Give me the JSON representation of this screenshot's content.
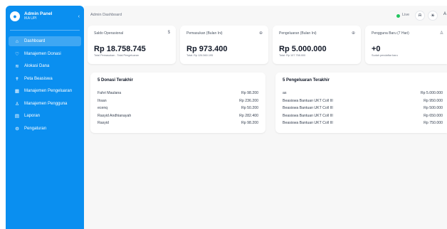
{
  "sidebar": {
    "brand_title": "Admin Panel",
    "brand_subtitle": "IKA UPI",
    "items": [
      {
        "label": "Dashboard",
        "icon": "home-icon",
        "glyph": "⌂"
      },
      {
        "label": "Manajemen Donasi",
        "icon": "donation-icon",
        "glyph": "♡"
      },
      {
        "label": "Alokasi Dana",
        "icon": "allocation-icon",
        "glyph": "≋"
      },
      {
        "label": "Peta Beasiswa",
        "icon": "map-pin-icon",
        "glyph": "✝"
      },
      {
        "label": "Manajemen Pengeluaran",
        "icon": "expense-icon",
        "glyph": "▦"
      },
      {
        "label": "Manajemen Pengguna",
        "icon": "users-icon",
        "glyph": "♙"
      },
      {
        "label": "Laporan",
        "icon": "report-icon",
        "glyph": "▤"
      },
      {
        "label": "Pengaturan",
        "icon": "settings-icon",
        "glyph": "⚙"
      }
    ]
  },
  "topbar": {
    "breadcrumb": "Admin Dashboard",
    "live_label": "Live",
    "user_initial": "A"
  },
  "stats": [
    {
      "label": "Saldo Operasional",
      "icon": "$",
      "value": "Rp 18.758.745",
      "note": "Total Pemasukan - Total Pengeluaran"
    },
    {
      "label": "Pemasukan (Bulan Ini)",
      "icon": "⊕",
      "value": "Rp 973.400",
      "note": "Total: Rp 126.560.195"
    },
    {
      "label": "Pengeluaran (Bulan Ini)",
      "icon": "⊕",
      "value": "Rp 5.000.000",
      "note": "Total: Rp 107.758.000"
    },
    {
      "label": "Pengguna Baru (7 Hari)",
      "icon": "♙",
      "value": "+0",
      "note": "Sudah pendaftar baru"
    }
  ],
  "donations": {
    "title": "5 Donasi Terakhir",
    "rows": [
      {
        "name": "Fahri Maulana",
        "amount": "Rp 98.200"
      },
      {
        "name": "Ihsan",
        "amount": "Rp 236.200"
      },
      {
        "name": "ecenq",
        "amount": "Rp 50.200"
      },
      {
        "name": "Rasyid Andhianayah",
        "amount": "Rp 282.400"
      },
      {
        "name": "Rasyid",
        "amount": "Rp 98.200"
      }
    ]
  },
  "expenses": {
    "title": "5 Pengeluaran Terakhir",
    "rows": [
      {
        "name": "as",
        "amount": "Rp 5.000.000"
      },
      {
        "name": "Beasiswa Bantuan UKT Coll III",
        "amount": "Rp 950.000"
      },
      {
        "name": "Beasiswa Bantuan UKT Coll III",
        "amount": "Rp 500.000"
      },
      {
        "name": "Beasiswa Bantuan UKT Coll III",
        "amount": "Rp 650.000"
      },
      {
        "name": "Beasiswa Bantuan UKT Coll III",
        "amount": "Rp 750.000"
      }
    ]
  }
}
